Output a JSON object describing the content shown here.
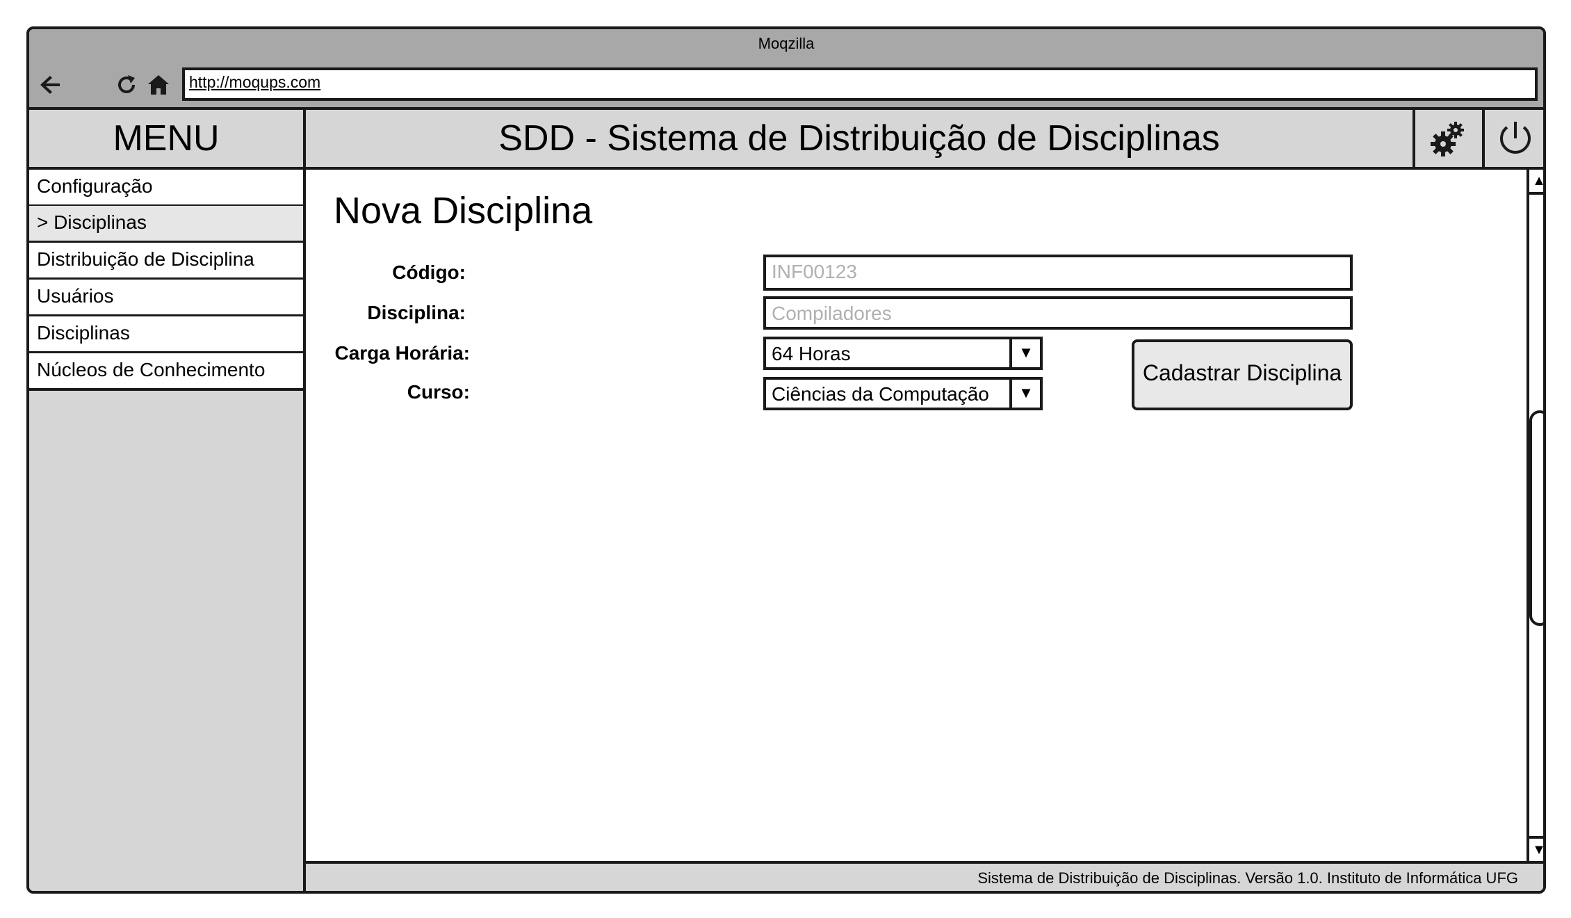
{
  "browser": {
    "title": "Moqzilla",
    "url": "http://moqups.com",
    "icons": {
      "back": "arrow-left-icon",
      "reload": "reload-icon",
      "home": "home-icon"
    }
  },
  "header": {
    "menu_title": "MENU",
    "app_title": "SDD - Sistema de Distribuição de Disciplinas",
    "icons": {
      "settings": "gears-icon",
      "power": "power-icon"
    }
  },
  "sidebar": {
    "items": [
      {
        "label": "Configuração"
      },
      {
        "label": "> Disciplinas"
      },
      {
        "label": "Distribuição de Disciplina"
      },
      {
        "label": "Usuários"
      },
      {
        "label": "Disciplinas"
      },
      {
        "label": "Núcleos de Conhecimento"
      }
    ]
  },
  "form": {
    "title": "Nova Disciplina",
    "codigo": {
      "label": "Código:",
      "placeholder": "INF00123"
    },
    "disciplina": {
      "label": "Disciplina:",
      "placeholder": "Compiladores"
    },
    "carga": {
      "label": "Carga Horária:",
      "value": "64 Horas"
    },
    "curso": {
      "label": "Curso:",
      "value": "Ciências da Computação"
    },
    "submit_label": "Cadastrar Disciplina"
  },
  "footer": {
    "text": "Sistema de Distribuição de Disciplinas. Versão 1.0. Instituto de Informática UFG"
  }
}
